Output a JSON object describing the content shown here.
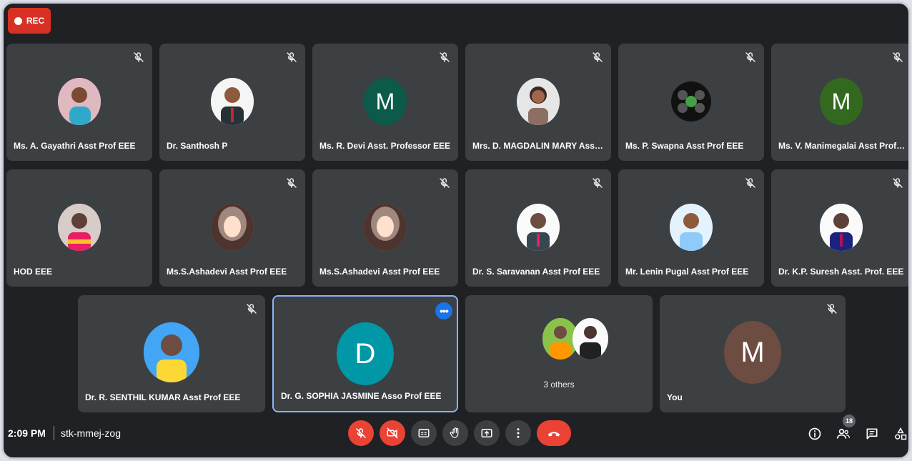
{
  "recording": {
    "label": "REC"
  },
  "participants": [
    {
      "name": "Ms. A. Gayathri Asst Prof EEE",
      "avatar": "photo"
    },
    {
      "name": "Dr. Santhosh P",
      "avatar": "photo"
    },
    {
      "name": "Ms. R. Devi Asst. Professor EEE",
      "avatar": "letter",
      "letter": "M",
      "color": "#0b5a4a"
    },
    {
      "name": "Mrs. D. MAGDALIN MARY Asst ...",
      "avatar": "photo"
    },
    {
      "name": "Ms. P. Swapna Asst Prof EEE",
      "avatar": "photo"
    },
    {
      "name": "Ms. V. Manimegalai Asst Prof E...",
      "avatar": "letter",
      "letter": "M",
      "color": "#33691e"
    },
    {
      "name": "HOD EEE",
      "avatar": "photo"
    },
    {
      "name": "Ms.S.Ashadevi Asst Prof EEE",
      "avatar": "photo"
    },
    {
      "name": "Ms.S.Ashadevi Asst Prof EEE",
      "avatar": "photo"
    },
    {
      "name": "Dr. S. Saravanan Asst Prof EEE",
      "avatar": "photo"
    },
    {
      "name": "Mr. Lenin Pugal Asst Prof EEE",
      "avatar": "photo"
    },
    {
      "name": "Dr. K.P. Suresh Asst. Prof. EEE",
      "avatar": "photo"
    },
    {
      "name": "Dr. R. SENTHIL KUMAR Asst Prof EEE",
      "avatar": "photo"
    },
    {
      "name": "Dr. G. SOPHIA JASMINE Asso Prof EEE",
      "avatar": "letter",
      "letter": "D",
      "color": "#0097a7",
      "active": true
    },
    {
      "name": "You",
      "avatar": "letter",
      "letter": "M",
      "color": "#6d4c41"
    }
  ],
  "others": {
    "label": "3 others"
  },
  "meeting": {
    "time": "2:09 PM",
    "code": "stk-mmej-zog"
  },
  "people_count": "18",
  "icons": {
    "mute": "mic-off-icon",
    "camera": "camera-off-icon",
    "captions": "captions-icon",
    "hand": "raise-hand-icon",
    "present": "present-icon",
    "more": "more-vert-icon",
    "end": "end-call-icon",
    "info": "info-icon",
    "people": "people-icon",
    "chat": "chat-icon",
    "activities": "activities-icon"
  }
}
